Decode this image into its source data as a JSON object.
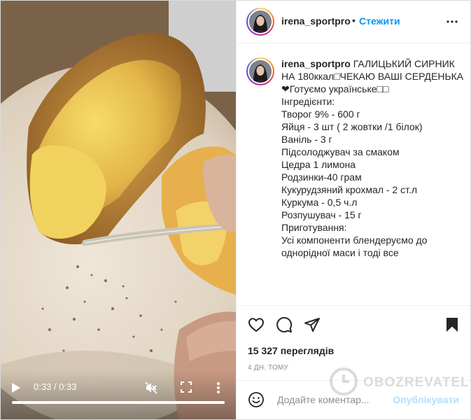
{
  "post": {
    "username": "irena_sportpro",
    "dot": "•",
    "follow_label": "Стежити"
  },
  "caption": {
    "username": "irena_sportpro",
    "lines": [
      " ГАЛИЦЬКИЙ СИРНИК",
      "НА 180ккал□ЧЕКАЮ ВАШІ СЕРДЕНЬКА",
      "❤Готуємо українське□□",
      "",
      "Інгредієнти:",
      "",
      "Творог 9% - 600 г",
      "Яйця - 3 шт ( 2 жовтки /1 білок)",
      "Ваніль - 3 г",
      "Підсолоджувач за смаком",
      "Цедра 1 лимона",
      "Родзинки-40 грам",
      "Кукурудзяний крохмал - 2 ст.л",
      "Куркума - 0,5 ч.л",
      "Розпушувач - 15 г",
      "",
      "Приготування:",
      "",
      "Усі компоненти блендеруємо до",
      "однорідної маси і тоді все"
    ]
  },
  "video": {
    "time": "0:33 / 0:33",
    "progress": 1.0
  },
  "stats": {
    "views": "15 327 переглядів",
    "date": "4 дн. тому"
  },
  "comment": {
    "placeholder": "Додайте коментар...",
    "publish_label": "Опублікувати"
  },
  "watermark": {
    "text": "OBOZREVATEL"
  },
  "icons": {
    "header_menu": "more-horizontal-icon",
    "like": "heart-icon",
    "comment": "comment-icon",
    "share": "send-icon",
    "save": "bookmark-icon",
    "emoji": "smiley-icon",
    "play": "play-icon",
    "mute": "muted-speaker-icon",
    "fullscreen": "fullscreen-icon",
    "video_menu": "more-vertical-icon"
  }
}
